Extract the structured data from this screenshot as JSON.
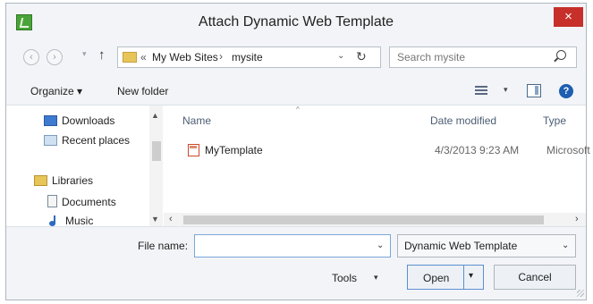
{
  "window": {
    "title": "Attach Dynamic Web Template",
    "close_label": "×"
  },
  "nav": {
    "back_icon": "‹",
    "forward_icon": "›",
    "dropdown_icon": "▾",
    "up_icon": "↑",
    "address": {
      "chevrons": "«",
      "crumb1": "My Web Sites",
      "separator": "›",
      "crumb2": "mysite",
      "dropdown": "⌄",
      "refresh": "↻"
    },
    "search_placeholder": "Search mysite"
  },
  "toolbar": {
    "organize": "Organize ▾",
    "new_folder": "New folder",
    "view_dropdown": "▾",
    "help": "?"
  },
  "sidebar": {
    "items": [
      {
        "label": "Downloads",
        "icon": "downloads-icon"
      },
      {
        "label": "Recent places",
        "icon": "recent-places-icon"
      },
      {
        "label": "Libraries",
        "icon": "libraries-icon"
      },
      {
        "label": "Documents",
        "icon": "documents-icon"
      },
      {
        "label": "Music",
        "icon": "music-icon"
      }
    ]
  },
  "columns": {
    "name": "Name",
    "date_modified": "Date modified",
    "type": "Type"
  },
  "files": [
    {
      "name": "MyTemplate",
      "date": "4/3/2013 9:23 AM",
      "type": "Microsoft"
    }
  ],
  "scroll": {
    "up": "▲",
    "down": "▼",
    "left": "‹",
    "right": "›",
    "sort": "^"
  },
  "footer": {
    "file_name_label": "File name:",
    "file_name_value": "",
    "input_dropdown": "⌄",
    "file_type": "Dynamic Web Template",
    "file_type_dropdown": "⌄",
    "tools": "Tools",
    "tools_dropdown": "▾",
    "open": "Open",
    "open_split": "▾",
    "cancel": "Cancel"
  }
}
